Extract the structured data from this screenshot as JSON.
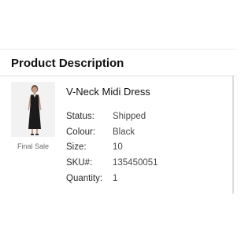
{
  "section": {
    "title": "Product Description"
  },
  "product": {
    "name": "V-Neck Midi Dress",
    "badge": "Final Sale",
    "image_icon": "product-photo",
    "details": [
      {
        "label": "Status:",
        "value": "Shipped"
      },
      {
        "label": "Colour:",
        "value": "Black"
      },
      {
        "label": "Size:",
        "value": "10"
      },
      {
        "label": "SKU#:",
        "value": "135450051"
      },
      {
        "label": "Quantity:",
        "value": "1"
      }
    ]
  },
  "colors": {
    "text": "#111111",
    "muted": "#6a6a6a",
    "divider": "#e2e2e2",
    "dress": "#1b1b1b"
  }
}
